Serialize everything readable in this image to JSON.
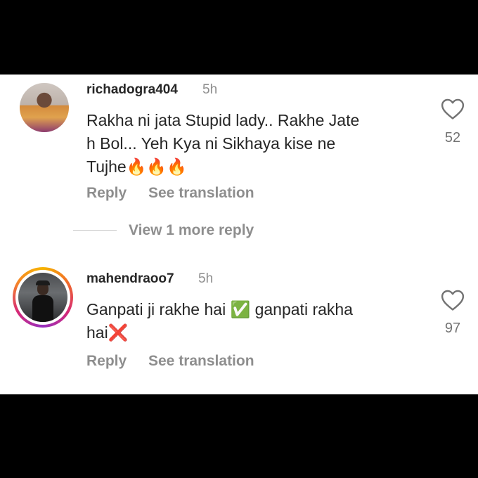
{
  "comments": [
    {
      "username": "richadogra404",
      "time": "5h",
      "lines": [
        "Rakha ni jata Stupid lady.. Rakhe Jate",
        "h Bol... Yeh Kya ni Sikhaya kise ne",
        "Tujhe🔥🔥🔥"
      ],
      "likes": "52",
      "reply_label": "Reply",
      "translate_label": "See translation"
    },
    {
      "username": "mahendraoo7",
      "time": "5h",
      "lines": [
        "Ganpati ji rakhe hai ✅ ganpati rakha",
        "hai❌"
      ],
      "likes": "97",
      "reply_label": "Reply",
      "translate_label": "See translation"
    }
  ],
  "view_more_label": "View 1 more reply",
  "icons": {
    "like": "heart-outline-icon"
  },
  "colors": {
    "username": "#262626",
    "secondary": "#8e8e8e",
    "background": "#ffffff"
  }
}
